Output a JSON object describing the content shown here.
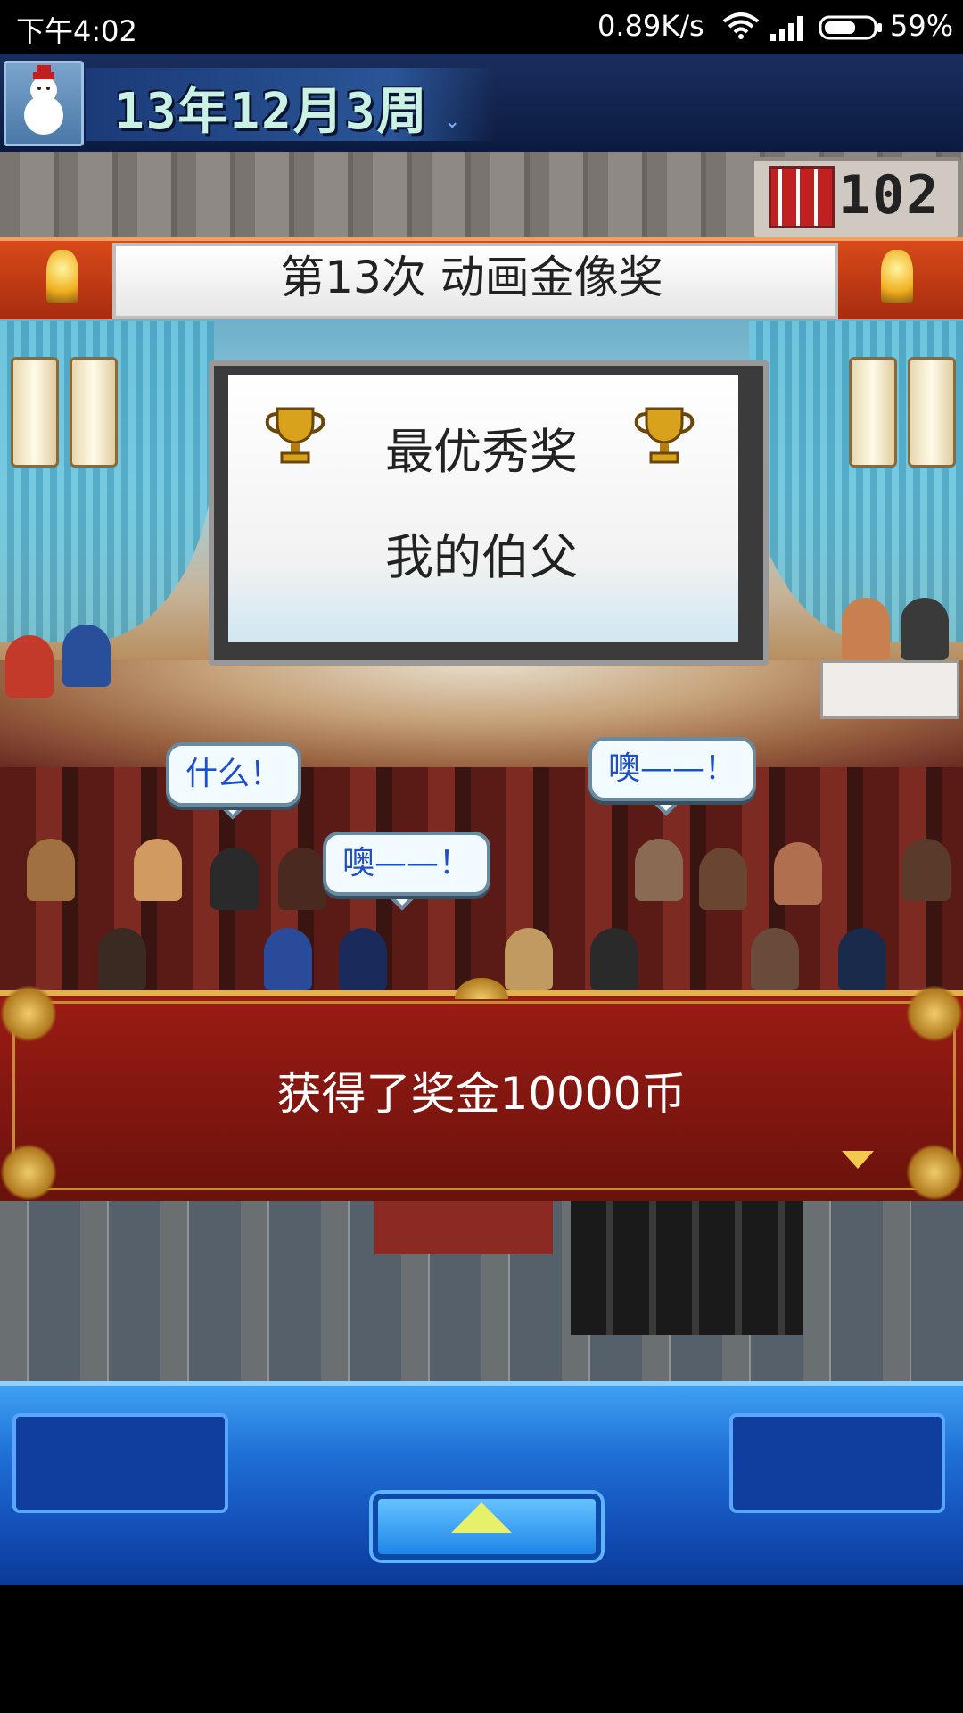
{
  "status_bar": {
    "time": "下午4:02",
    "net_speed": "0.89K/s",
    "battery_percent": "59%"
  },
  "game_header": {
    "date": "13年12月3周",
    "points": "102"
  },
  "ceremony": {
    "title": "第13次 动画金像奖",
    "award_name": "最优秀奖",
    "winner": "我的伯父"
  },
  "speech_bubbles": [
    "什么！",
    "噢——！",
    "噢——！"
  ],
  "message": {
    "text": "获得了奖金10000币"
  },
  "icons": {
    "trophy": "trophy-icon",
    "menu_toggle": "up-arrow-icon",
    "message_next": "chevron-down-icon"
  },
  "colors": {
    "banner_red": "#b83414",
    "message_red": "#7e160f",
    "menu_blue": "#1f6fd6",
    "bubble_text": "#1e4fc8",
    "gold": "#e3b24a"
  }
}
